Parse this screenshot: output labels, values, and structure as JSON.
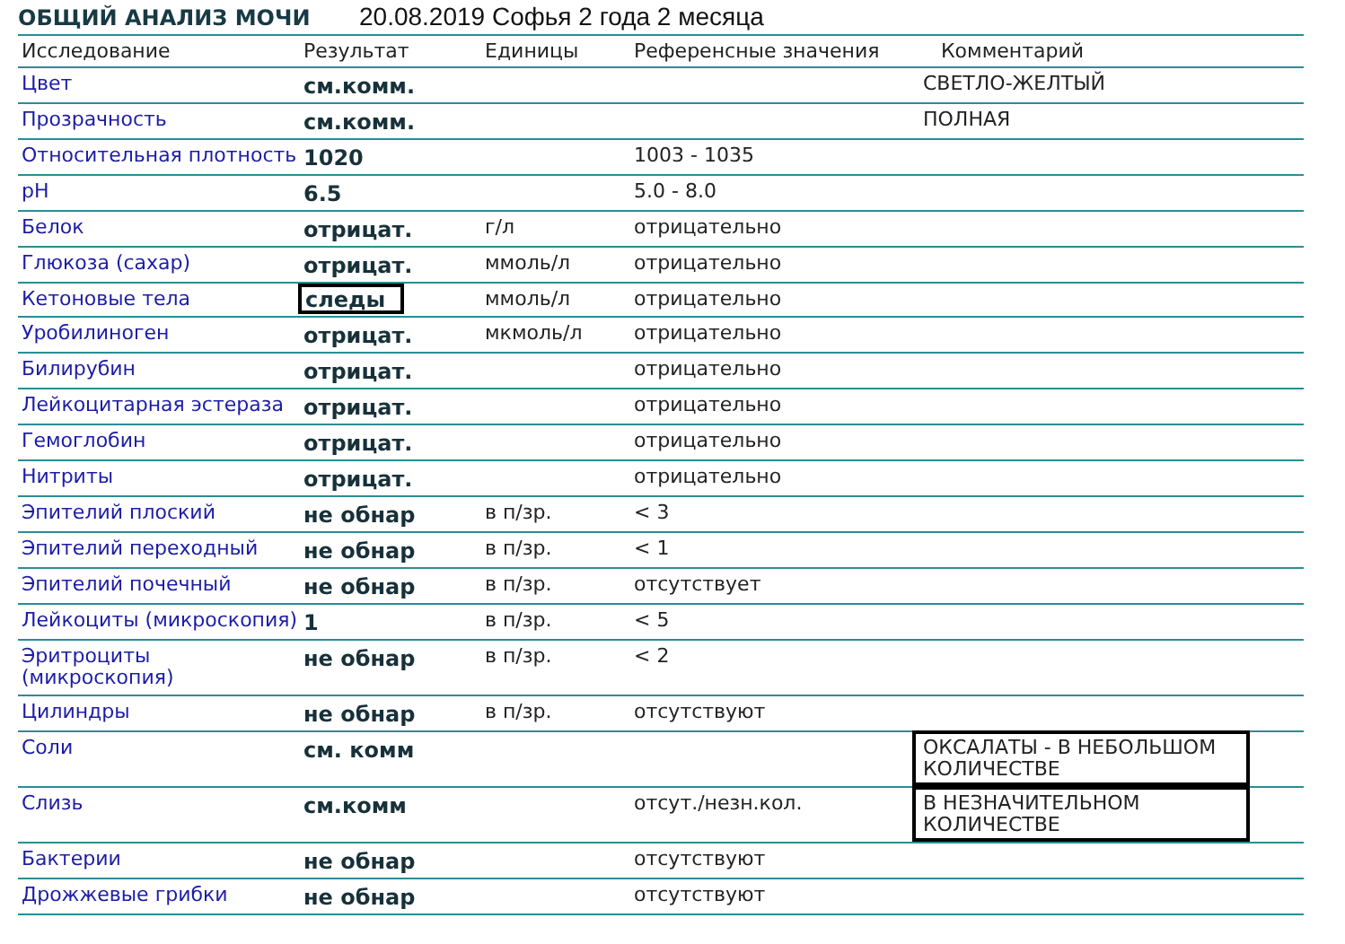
{
  "title": "ОБЩИЙ АНАЛИЗ МОЧИ",
  "subtitle": "20.08.2019 Софья 2 года 2 месяца",
  "columns": [
    "Исследование",
    "Результат",
    "Единицы",
    "Референсные значения",
    "Комментарий"
  ],
  "rows": [
    {
      "name": "Цвет",
      "result": "см.комм.",
      "comment": "СВЕТЛО-ЖЕЛТЫЙ",
      "result_marked": false,
      "comment_marked": false
    },
    {
      "name": "Прозрачность",
      "result": "см.комм.",
      "comment": "ПОЛНАЯ",
      "result_marked": false,
      "comment_marked": false
    },
    {
      "name": "Относительная плотность",
      "result": "1020",
      "reference": "1003 - 1035",
      "result_marked": false,
      "comment_marked": false
    },
    {
      "name": "pH",
      "result": "6.5",
      "reference": "5.0 - 8.0",
      "result_marked": false,
      "comment_marked": false
    },
    {
      "name": "Белок",
      "result": "отрицат.",
      "units": "г/л",
      "reference": "отрицательно",
      "result_marked": false,
      "comment_marked": false
    },
    {
      "name": "Глюкоза (сахар)",
      "result": "отрицат.",
      "units": "ммоль/л",
      "reference": "отрицательно",
      "result_marked": false,
      "comment_marked": false
    },
    {
      "name": "Кетоновые тела",
      "result": "следы",
      "units": "ммоль/л",
      "reference": "отрицательно",
      "result_marked": true,
      "comment_marked": false
    },
    {
      "name": "Уробилиноген",
      "result": "отрицат.",
      "units": "мкмоль/л",
      "reference": "отрицательно",
      "result_marked": false,
      "comment_marked": false
    },
    {
      "name": "Билирубин",
      "result": "отрицат.",
      "reference": "отрицательно",
      "result_marked": false,
      "comment_marked": false
    },
    {
      "name": "Лейкоцитарная эстераза",
      "result": "отрицат.",
      "reference": "отрицательно",
      "result_marked": false,
      "comment_marked": false
    },
    {
      "name": "Гемоглобин",
      "result": "отрицат.",
      "reference": "отрицательно",
      "result_marked": false,
      "comment_marked": false
    },
    {
      "name": "Нитриты",
      "result": "отрицат.",
      "reference": "отрицательно",
      "result_marked": false,
      "comment_marked": false
    },
    {
      "name": "Эпителий плоский",
      "result": "не обнар",
      "units": "в п/зр.",
      "reference": "< 3",
      "result_marked": false,
      "comment_marked": false
    },
    {
      "name": "Эпителий переходный",
      "result": "не обнар",
      "units": "в п/зр.",
      "reference": "< 1",
      "result_marked": false,
      "comment_marked": false
    },
    {
      "name": "Эпителий почечный",
      "result": "не обнар",
      "units": "в п/зр.",
      "reference": "отсутствует",
      "result_marked": false,
      "comment_marked": false
    },
    {
      "name": "Лейкоциты (микроскопия)",
      "result": "1",
      "units": "в п/зр.",
      "reference": "< 5",
      "result_marked": false,
      "comment_marked": false
    },
    {
      "name": "Эритроциты (микроскопия)",
      "result": "не обнар",
      "units": "в п/зр.",
      "reference": "< 2",
      "result_marked": false,
      "comment_marked": false
    },
    {
      "name": "Цилиндры",
      "result": "не обнар",
      "units": "в п/зр.",
      "reference": "отсутствуют",
      "result_marked": false,
      "comment_marked": false
    },
    {
      "name": "Соли",
      "result": "см. комм",
      "comment": "ОКСАЛАТЫ - В НЕБОЛЬШОМ КОЛИЧЕСТВЕ",
      "result_marked": false,
      "comment_marked": true
    },
    {
      "name": "Слизь",
      "result": "см.комм",
      "reference": "отсут./незн.кол.",
      "comment": "В НЕЗНАЧИТЕЛЬНОМ КОЛИЧЕСТВЕ",
      "result_marked": false,
      "comment_marked": true
    },
    {
      "name": "Бактерии",
      "result": "не обнар",
      "reference": "отсутствуют",
      "result_marked": false,
      "comment_marked": false
    },
    {
      "name": "Дрожжевые грибки",
      "result": "не обнар",
      "reference": "отсутствуют",
      "result_marked": false,
      "comment_marked": false
    }
  ]
}
